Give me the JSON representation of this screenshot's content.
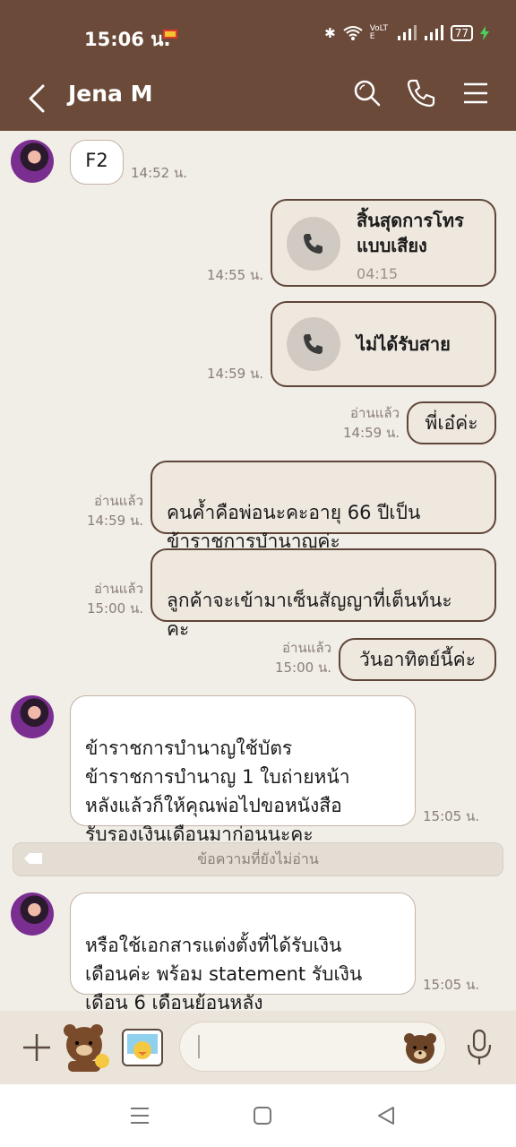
{
  "status": {
    "time": "15:06 น.",
    "battery": "77",
    "lte": "VoLTE"
  },
  "header": {
    "contact_name": "Jena M"
  },
  "messages": [
    {
      "text": "F2",
      "time": "14:52 น."
    },
    {
      "title": "สิ้นสุดการโทร\nแบบเสียง",
      "duration": "04:15",
      "time": "14:55 น."
    },
    {
      "title": "ไม่ได้รับสาย",
      "time": "14:59 น."
    },
    {
      "text": "พี่เอ๋ค่ะ",
      "read": "อ่านแล้ว",
      "time": "14:59 น."
    },
    {
      "text": "คนค้ำคือพ่อนะคะอายุ 66 ปีเป็น\nข้าราชการบำนาญค่ะ",
      "read": "อ่านแล้ว",
      "time": "14:59 น."
    },
    {
      "text": "ลูกค้าจะเข้ามาเซ็นสัญญาที่เต็นท์นะ\nคะ",
      "read": "อ่านแล้ว",
      "time": "15:00 น."
    },
    {
      "text": "วันอาทิตย์นี้ค่ะ",
      "read": "อ่านแล้ว",
      "time": "15:00 น."
    },
    {
      "text": "ข้าราชการบำนาญใช้บัตร\nข้าราชการบำนาญ 1 ใบถ่ายหน้า\nหลังแล้วก็ให้คุณพ่อไปขอหนังสือ\nรับรองเงินเดือนมาก่อนนะคะ",
      "time": "15:05 น."
    },
    {
      "text": "หรือใช้เอกสารแต่งตั้งที่ได้รับเงิน\nเดือนค่ะ พร้อม statement รับเงิน\nเดือน 6 เดือนย้อนหลัง",
      "time": "15:05 น."
    }
  ],
  "unread_divider": "ข้อความที่ยังไม่อ่าน"
}
